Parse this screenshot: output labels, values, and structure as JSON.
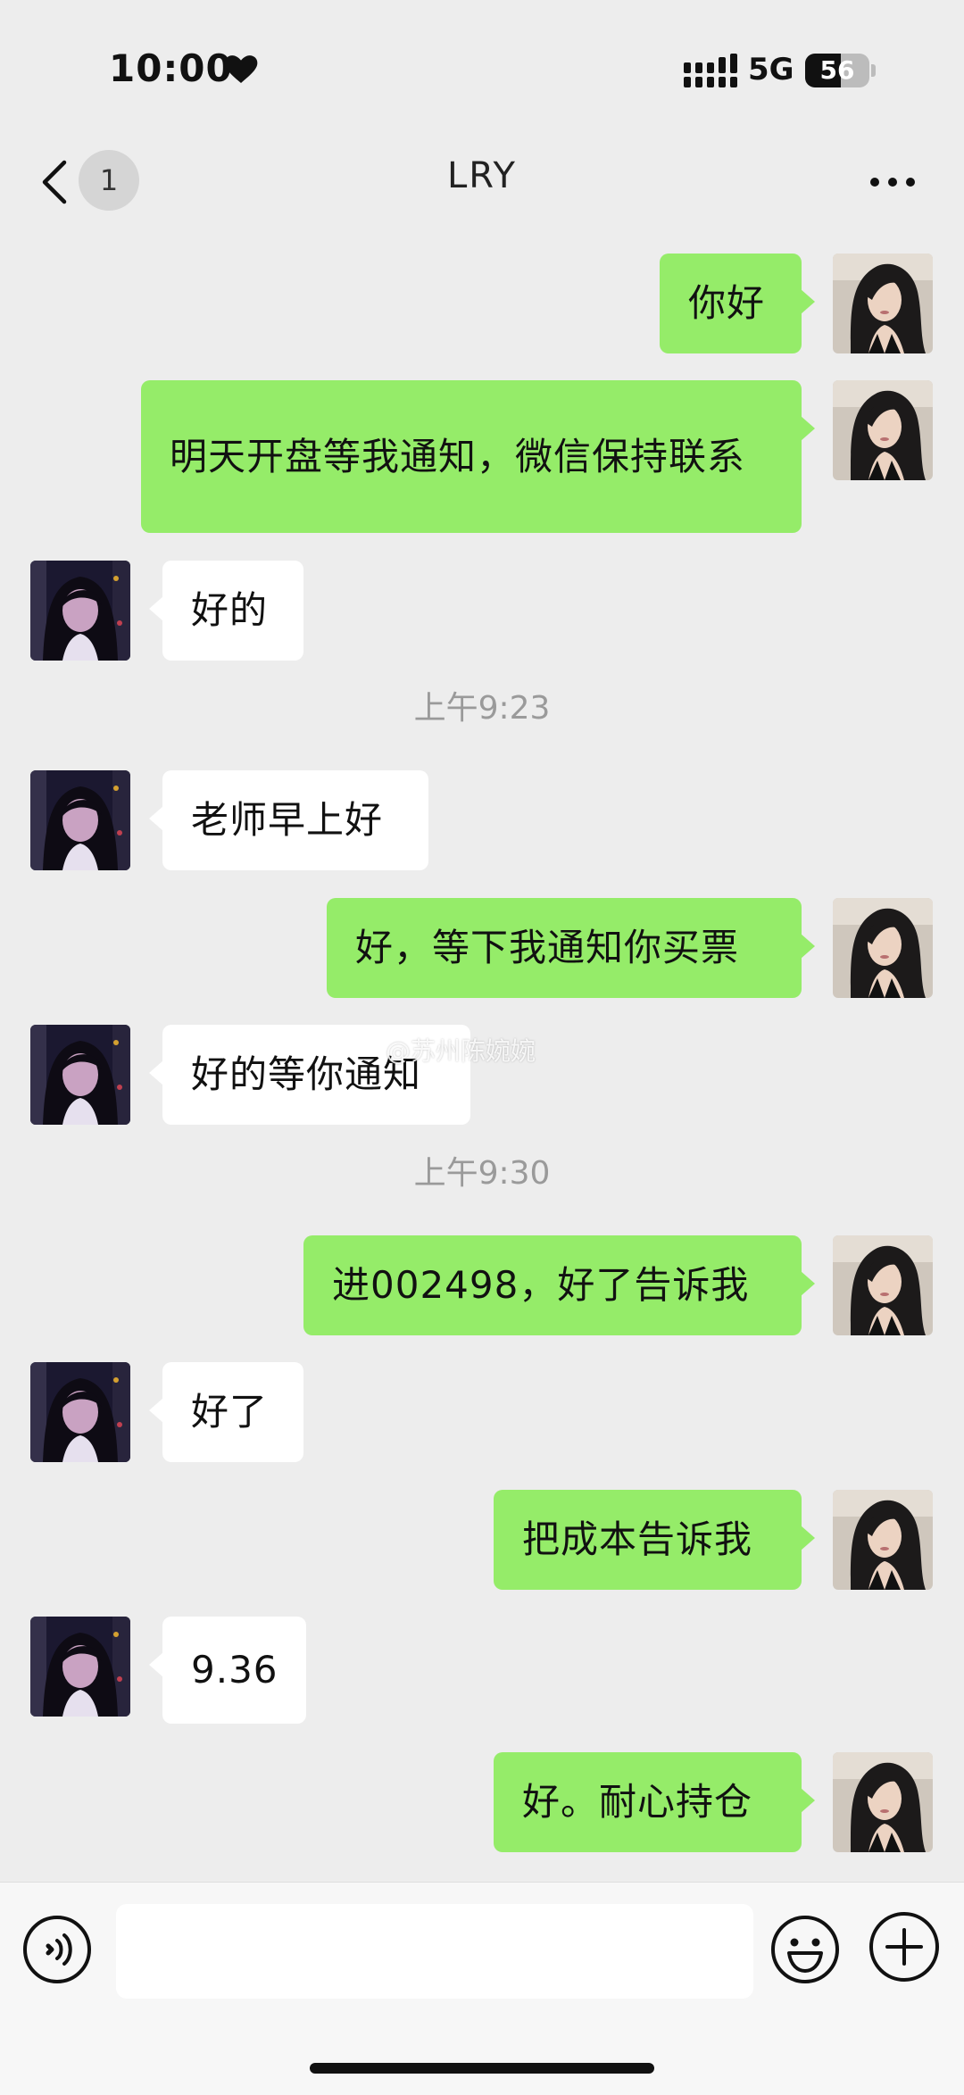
{
  "status_bar": {
    "time": "10:00",
    "network": "5G",
    "battery": "56",
    "battery_level": 0.56,
    "heart_icon": "heart-icon",
    "signal_icon": "signal-icon"
  },
  "nav": {
    "title": "LRY",
    "unread_count": "1",
    "back_icon": "chevron-left-icon",
    "more_icon": "more-icon"
  },
  "messages": [
    {
      "side": "sent",
      "text": "你好"
    },
    {
      "side": "sent",
      "text": "明天开盘等我通知，微信保持联系"
    },
    {
      "side": "recv",
      "text": "好的"
    },
    {
      "type": "timestamp",
      "text": "上午9:23"
    },
    {
      "side": "recv",
      "text": "老师早上好"
    },
    {
      "side": "sent",
      "text": "好，等下我通知你买票"
    },
    {
      "side": "recv",
      "text": "好的等你通知"
    },
    {
      "type": "timestamp",
      "text": "上午9:30"
    },
    {
      "side": "sent",
      "text": "进002498，好了告诉我"
    },
    {
      "side": "recv",
      "text": "好了"
    },
    {
      "side": "sent",
      "text": "把成本告诉我"
    },
    {
      "side": "recv",
      "text": "9.36"
    },
    {
      "side": "sent",
      "text": "好。耐心持仓"
    }
  ],
  "watermark": "@苏州陈婉婉",
  "input_bar": {
    "placeholder": "",
    "voice_icon": "voice-icon",
    "emoji_icon": "emoji-icon",
    "plus_icon": "plus-icon"
  },
  "colors": {
    "background": "#ededed",
    "sent_bubble": "#95ec69",
    "recv_bubble": "#ffffff",
    "timestamp": "#9a9a9a"
  }
}
